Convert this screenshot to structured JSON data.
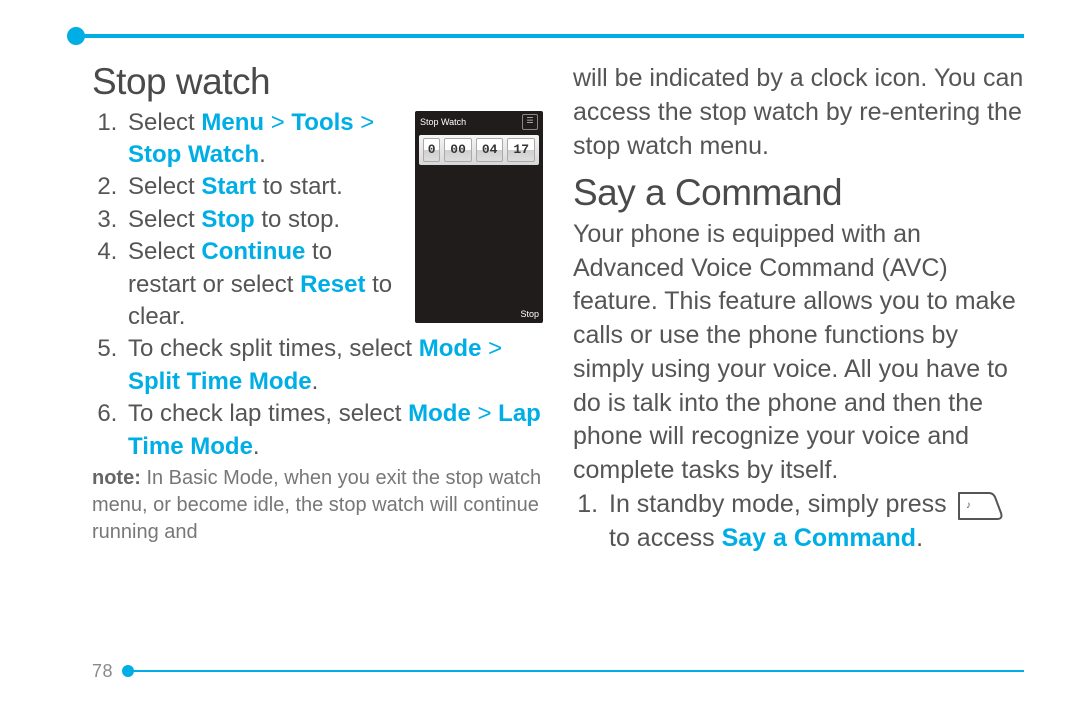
{
  "page_number": "78",
  "left": {
    "heading": "Stop watch",
    "steps": {
      "s1": {
        "pre": "Select ",
        "menu": "Menu",
        "gt1": " > ",
        "tools": "Tools",
        "gt2": " > ",
        "stopwatch": "Stop Watch",
        "post": "."
      },
      "s2": {
        "pre": "Select ",
        "start": "Start",
        "post": " to start."
      },
      "s3": {
        "pre": "Select ",
        "stop": "Stop",
        "post": " to stop."
      },
      "s4": {
        "pre": "Select ",
        "cont": "Continue",
        "mid": " to restart or select ",
        "reset": "Reset",
        "post": " to clear."
      },
      "s5": {
        "pre": "To check split times, select ",
        "mode": "Mode",
        "gt": " > ",
        "split": "Split Time Mode",
        "post": "."
      },
      "s6": {
        "pre": "To check lap times, select ",
        "mode": "Mode",
        "gt": " > ",
        "lap": "Lap Time Mode",
        "post": "."
      }
    },
    "note": {
      "label": "note:",
      "text": " In Basic Mode, when you exit the stop watch menu, or become idle, the stop watch will continue running and"
    }
  },
  "right": {
    "cont_text": "will be indicated by a clock icon. You can access the stop watch by re-entering the stop watch menu.",
    "heading": "Say a Command",
    "body": "Your phone is equipped with an Advanced Voice Command (AVC) feature. This feature allows you to make calls or use the phone functions by simply using your voice. All you have to do is talk into the phone and then the phone will recognize your voice and complete tasks by itself.",
    "step1": {
      "pre": "In standby mode, simply press",
      "mid": " to access ",
      "say": "Say a Command",
      "post": "."
    }
  },
  "phone": {
    "title": "Stop Watch",
    "digits": [
      "0",
      "00",
      "04",
      "17"
    ],
    "softkey": "Stop"
  }
}
